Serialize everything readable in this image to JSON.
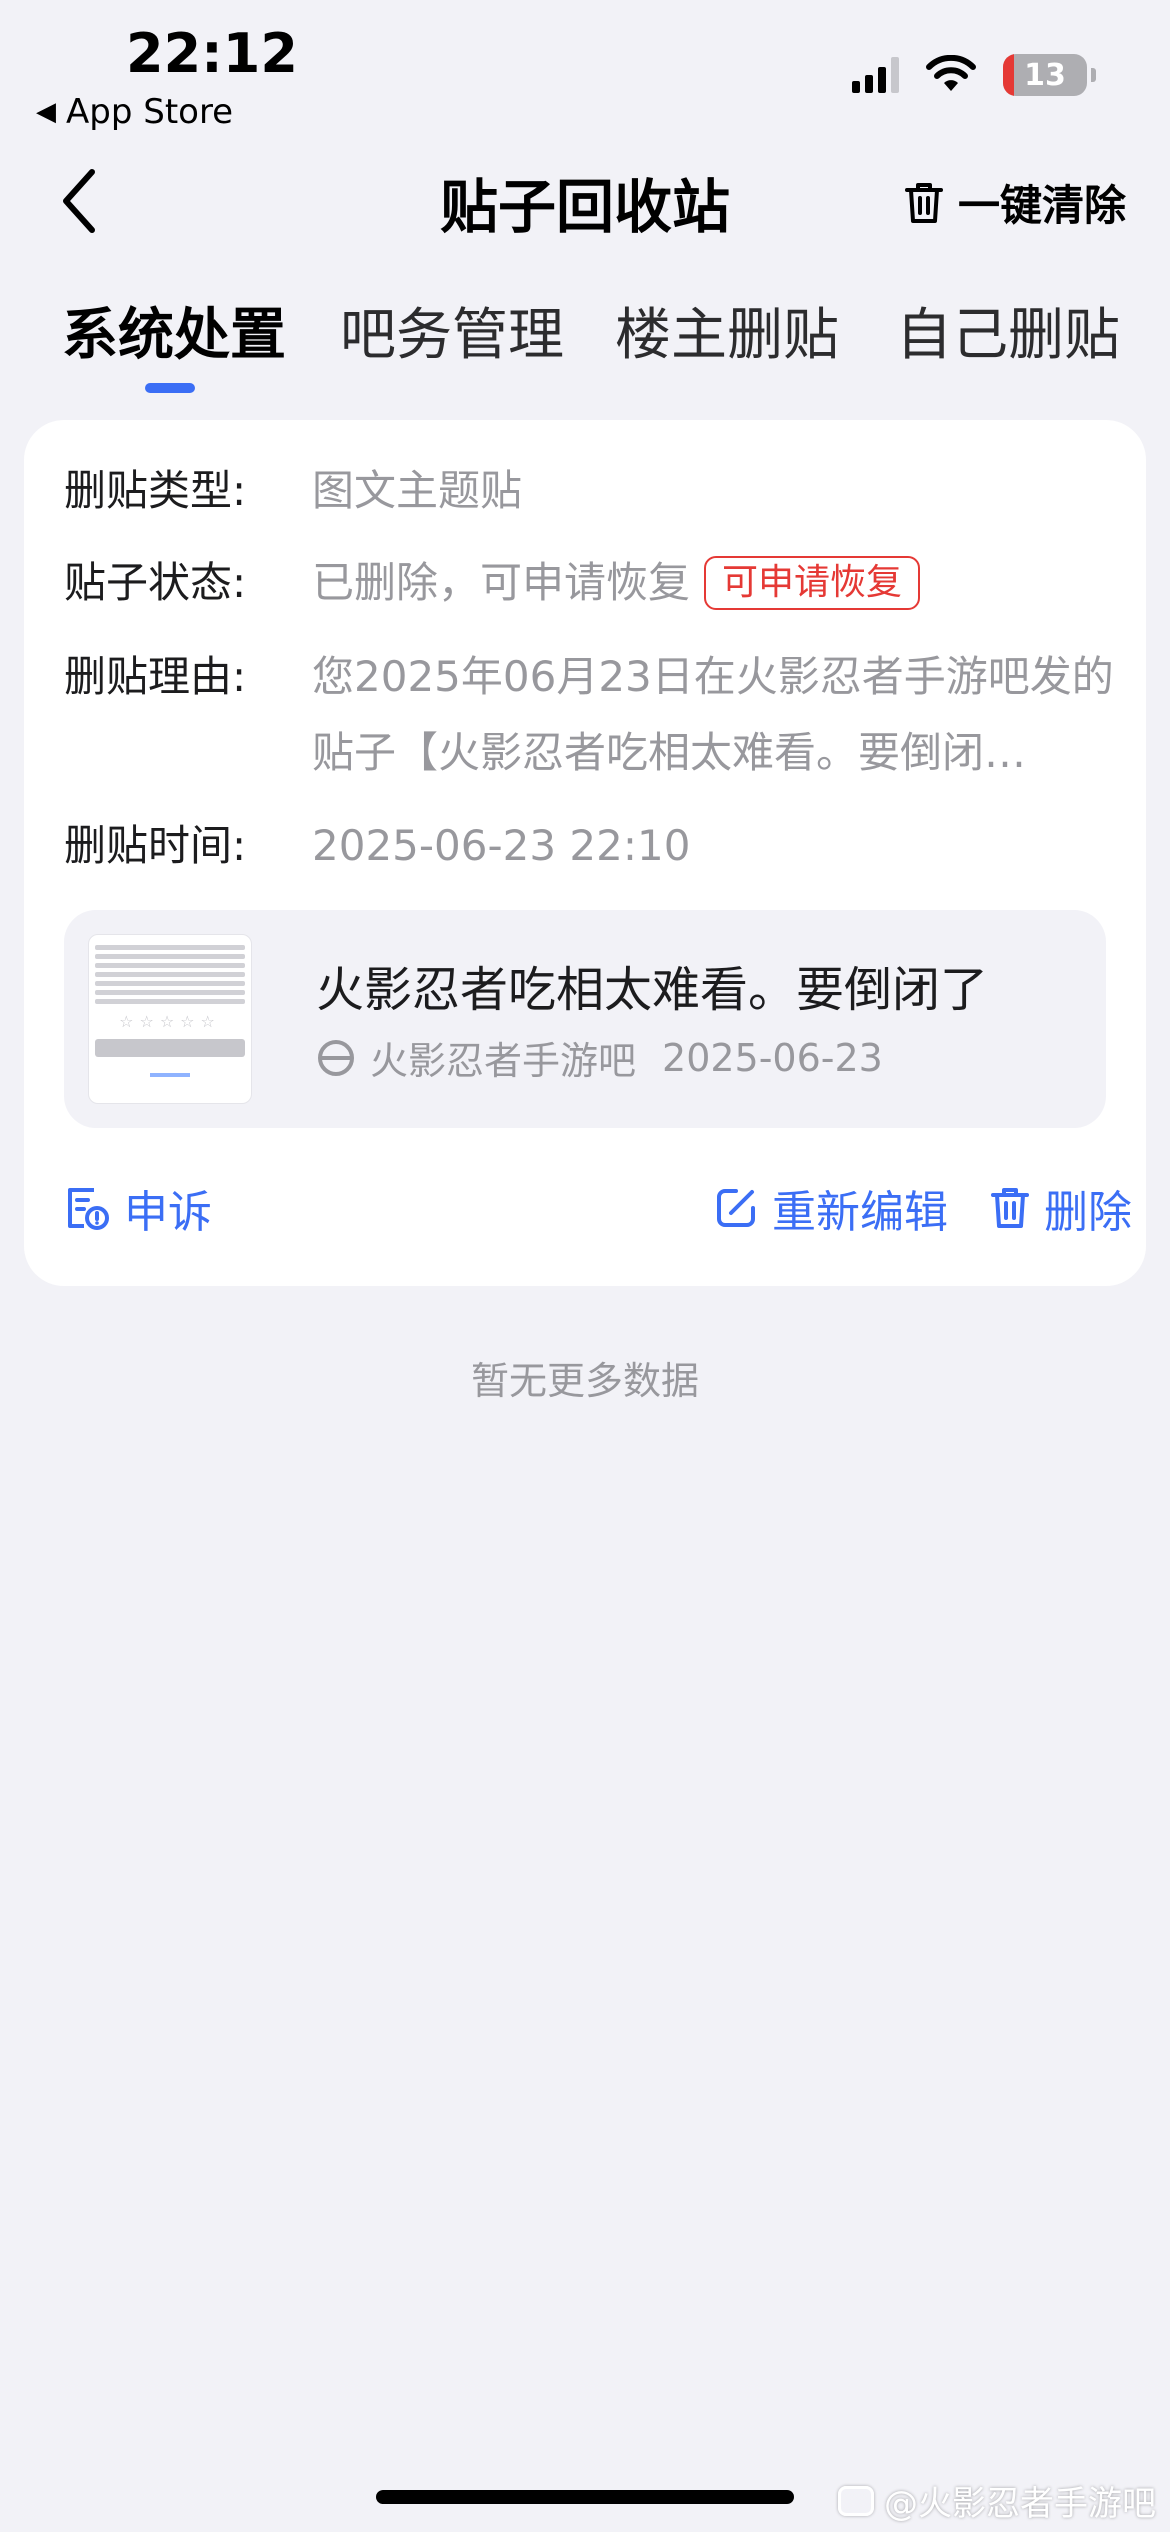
{
  "status_bar": {
    "time": "22:12",
    "back_app": "App Store",
    "battery": "13",
    "battery_level_percent": 13
  },
  "nav": {
    "title": "贴子回收站",
    "clear_all": "一键清除"
  },
  "tabs": [
    {
      "label": "系统处置",
      "active": true
    },
    {
      "label": "吧务管理",
      "active": false
    },
    {
      "label": "楼主删贴",
      "active": false
    },
    {
      "label": "自己删贴",
      "active": false
    }
  ],
  "card": {
    "type_label": "删贴类型:",
    "type_value": "图文主题贴",
    "status_label": "贴子状态:",
    "status_value": "已删除，可申请恢复",
    "status_badge": "可申请恢复",
    "reason_label": "删贴理由:",
    "reason_value": "您2025年06月23日在火影忍者手游吧发的贴子【火影忍者吃相太难看。要倒闭…",
    "time_label": "删贴时间:",
    "time_value": "2025-06-23 22:10",
    "post": {
      "title": "火影忍者吃相太难看。要倒闭了",
      "forum": "火影忍者手游吧",
      "date": "2025-06-23"
    },
    "actions": {
      "appeal": "申诉",
      "re_edit": "重新编辑",
      "delete": "删除"
    }
  },
  "footer": {
    "no_more": "暂无更多数据",
    "watermark": "@火影忍者手游吧"
  },
  "colors": {
    "accent": "#3b6ef5",
    "badge_red": "#e53935",
    "background": "#f2f2f7"
  }
}
